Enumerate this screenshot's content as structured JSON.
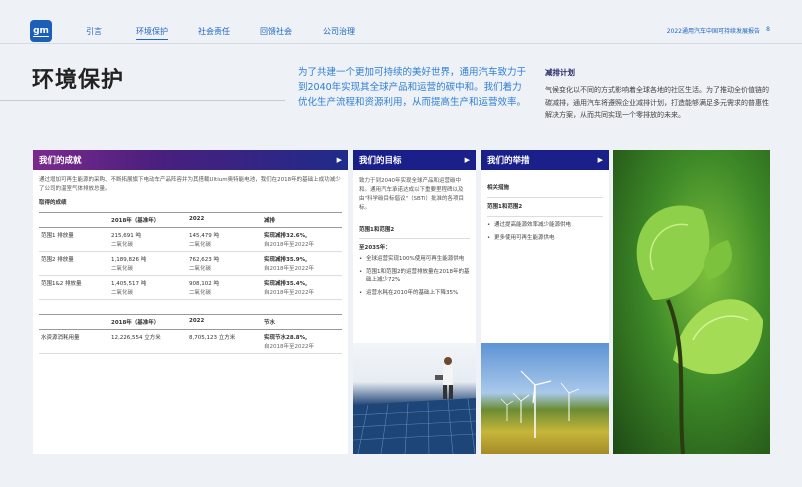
{
  "nav": {
    "logo": "gm",
    "items": [
      "引言",
      "环境保护",
      "社会责任",
      "回馈社会",
      "公司治理"
    ],
    "active_index": 1,
    "report_title": "2022通用汽车中国可持续发展报告",
    "page_number": "8"
  },
  "page": {
    "title": "环境保护",
    "intro": "为了共建一个更加可持续的美好世界，通用汽车致力于到2040年实现其全球产品和运营的碳中和。我们着力优化生产流程和资源利用，从而提高生产和运营效率。",
    "side_heading": "减排计划",
    "side_text": "气候变化以不同的方式影响着全球各地的社区生活。为了推动全价值链的碳减排，通用汽车将遵照企业减排计划，打造能够满足多元需求的普惠性解决方案，从而共同实现一个零排放的未来。"
  },
  "achievements": {
    "header": "我们的成就",
    "lead": "通过增加可再生能源的采购、不断拓展旗下电动车产品阵容并为其搭载Ultium奥特能电池，我们在2018年的基础上成功减少了公司的温室气体排放总量。",
    "subhead": "取得的成绩",
    "table1": {
      "headers": [
        "",
        "2018年（基准年）",
        "2022",
        "减排"
      ],
      "rows": [
        {
          "label": "范围1 排放量",
          "base": "215,691 吨",
          "base_unit": "二氧化碳",
          "y2022": "145,479 吨",
          "y2022_unit": "二氧化碳",
          "result": "实现减排32.6%,",
          "note": "自2018年至2022年"
        },
        {
          "label": "范围2 排放量",
          "base": "1,189,826 吨",
          "base_unit": "二氧化碳",
          "y2022": "762,623 吨",
          "y2022_unit": "二氧化碳",
          "result": "实现减排35.9%,",
          "note": "自2018年至2022年"
        },
        {
          "label": "范围1&2 排放量",
          "base": "1,405,517 吨",
          "base_unit": "二氧化碳",
          "y2022": "908,102 吨",
          "y2022_unit": "二氧化碳",
          "result": "实现减排35.4%,",
          "note": "自2018年至2022年"
        }
      ]
    },
    "table2": {
      "headers": [
        "",
        "2018年（基准年）",
        "2022",
        "节水"
      ],
      "rows": [
        {
          "label": "水资源消耗用量",
          "base": "12,226,554 立方米",
          "y2022": "8,705,123 立方米",
          "result": "实现节水28.8%,",
          "note": "自2018年至2022年"
        }
      ]
    }
  },
  "goals": {
    "header": "我们的目标",
    "text": "致力于到2040年实现全球产品和运营碳中和。通用汽车承诺达成以下重要里程碑以及由\"科学碳目标倡议\"（SBTi）批准的各项目标。",
    "scope_heading": "范围1和范围2",
    "year_heading": "至2035年：",
    "items": [
      "全球运营实现100%使用可再生能源供电",
      "范围1和范围2的运营排放量在2018年的基础上减少72%",
      "运营水耗在2010年的基础上下降35%"
    ]
  },
  "measures": {
    "header": "我们的举措",
    "subhead": "相关措施",
    "scope_heading": "范围1和范围2",
    "items": [
      "通过提高能源效率减少能源供电",
      "更多使用可再生能源供电"
    ]
  },
  "arrow": "▶"
}
